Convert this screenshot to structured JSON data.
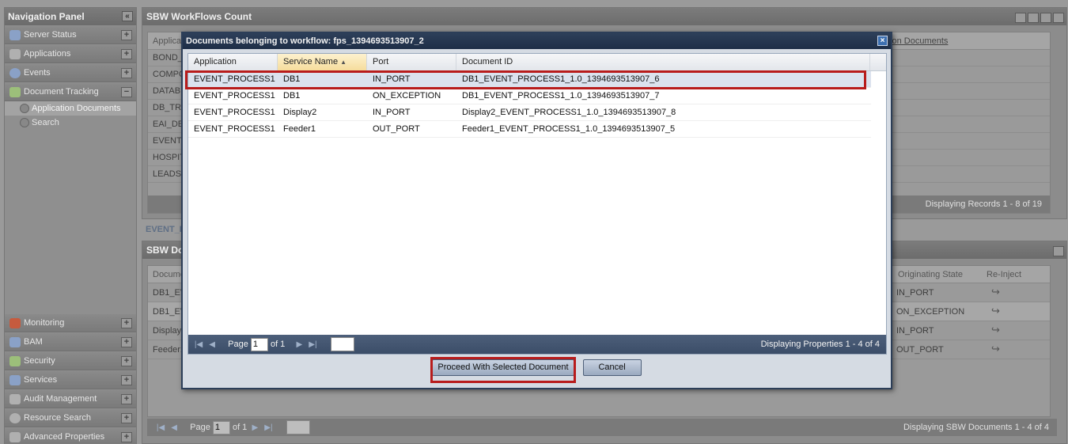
{
  "nav": {
    "title": "Navigation Panel",
    "items_top": [
      {
        "label": "Server Status",
        "icon": "server-status-icon"
      },
      {
        "label": "Applications",
        "icon": "applications-icon"
      },
      {
        "label": "Events",
        "icon": "info-icon"
      },
      {
        "label": "Document Tracking",
        "icon": "document-tracking-icon"
      }
    ],
    "sub_items": [
      {
        "label": "Application Documents",
        "active": true
      },
      {
        "label": "Search",
        "active": false
      }
    ],
    "items_bottom": [
      {
        "label": "Monitoring",
        "icon": "monitoring-icon"
      },
      {
        "label": "BAM",
        "icon": "bam-icon"
      },
      {
        "label": "Security",
        "icon": "security-icon"
      },
      {
        "label": "Services",
        "icon": "services-icon"
      },
      {
        "label": "Audit Management",
        "icon": "audit-management-icon"
      },
      {
        "label": "Resource Search",
        "icon": "resource-search-icon"
      },
      {
        "label": "Advanced Properties",
        "icon": "advanced-properties-icon"
      }
    ]
  },
  "top_panel": {
    "title": "SBW WorkFlows Count",
    "col_first": "Applica",
    "col_last": "tion Documents",
    "rows": [
      "BOND_",
      "COMPO",
      "DATAB",
      "DB_TRA",
      "EAI_DE",
      "EVENT_",
      "HOSPIT",
      "LEADST"
    ],
    "pager_text": "Displaying Records 1 - 8 of 19"
  },
  "breadcrumb": "EVENT_P",
  "bottom_panel": {
    "title": "SBW Doc",
    "col_first": "Docume",
    "col_orig": "Originating State",
    "col_reinject": "Re-Inject",
    "rows": [
      {
        "doc": "DB1_EV",
        "state": "IN_PORT"
      },
      {
        "doc": "DB1_EV",
        "state": "ON_EXCEPTION"
      },
      {
        "doc": "Display2",
        "state": "IN_PORT"
      },
      {
        "doc": "Feeder1",
        "state": "OUT_PORT"
      }
    ],
    "pager_page_label": "Page",
    "pager_page_value": "1",
    "pager_of": "of 1",
    "pager_text": "Displaying SBW Documents 1 - 4 of 4"
  },
  "modal": {
    "title": "Documents belonging to workflow: fps_1394693513907_2",
    "columns": [
      "Application",
      "Service Name",
      "Port",
      "Document ID"
    ],
    "rows": [
      {
        "application": "EVENT_PROCESS1",
        "service": "DB1",
        "port": "IN_PORT",
        "doc_id": "DB1_EVENT_PROCESS1_1.0_1394693513907_6"
      },
      {
        "application": "EVENT_PROCESS1",
        "service": "DB1",
        "port": "ON_EXCEPTION",
        "doc_id": "DB1_EVENT_PROCESS1_1.0_1394693513907_7"
      },
      {
        "application": "EVENT_PROCESS1",
        "service": "Display2",
        "port": "IN_PORT",
        "doc_id": "Display2_EVENT_PROCESS1_1.0_1394693513907_8"
      },
      {
        "application": "EVENT_PROCESS1",
        "service": "Feeder1",
        "port": "OUT_PORT",
        "doc_id": "Feeder1_EVENT_PROCESS1_1.0_1394693513907_5"
      }
    ],
    "pager": {
      "page_label": "Page",
      "page_value": "1",
      "of_label": "of 1",
      "status": "Displaying Properties 1 - 4 of 4"
    },
    "proceed_label": "Proceed With Selected Document",
    "cancel_label": "Cancel"
  },
  "colors": {
    "highlight": "#b81c1c",
    "modal_header": "#2d3f59",
    "selected_row": "#dbe2ee"
  }
}
